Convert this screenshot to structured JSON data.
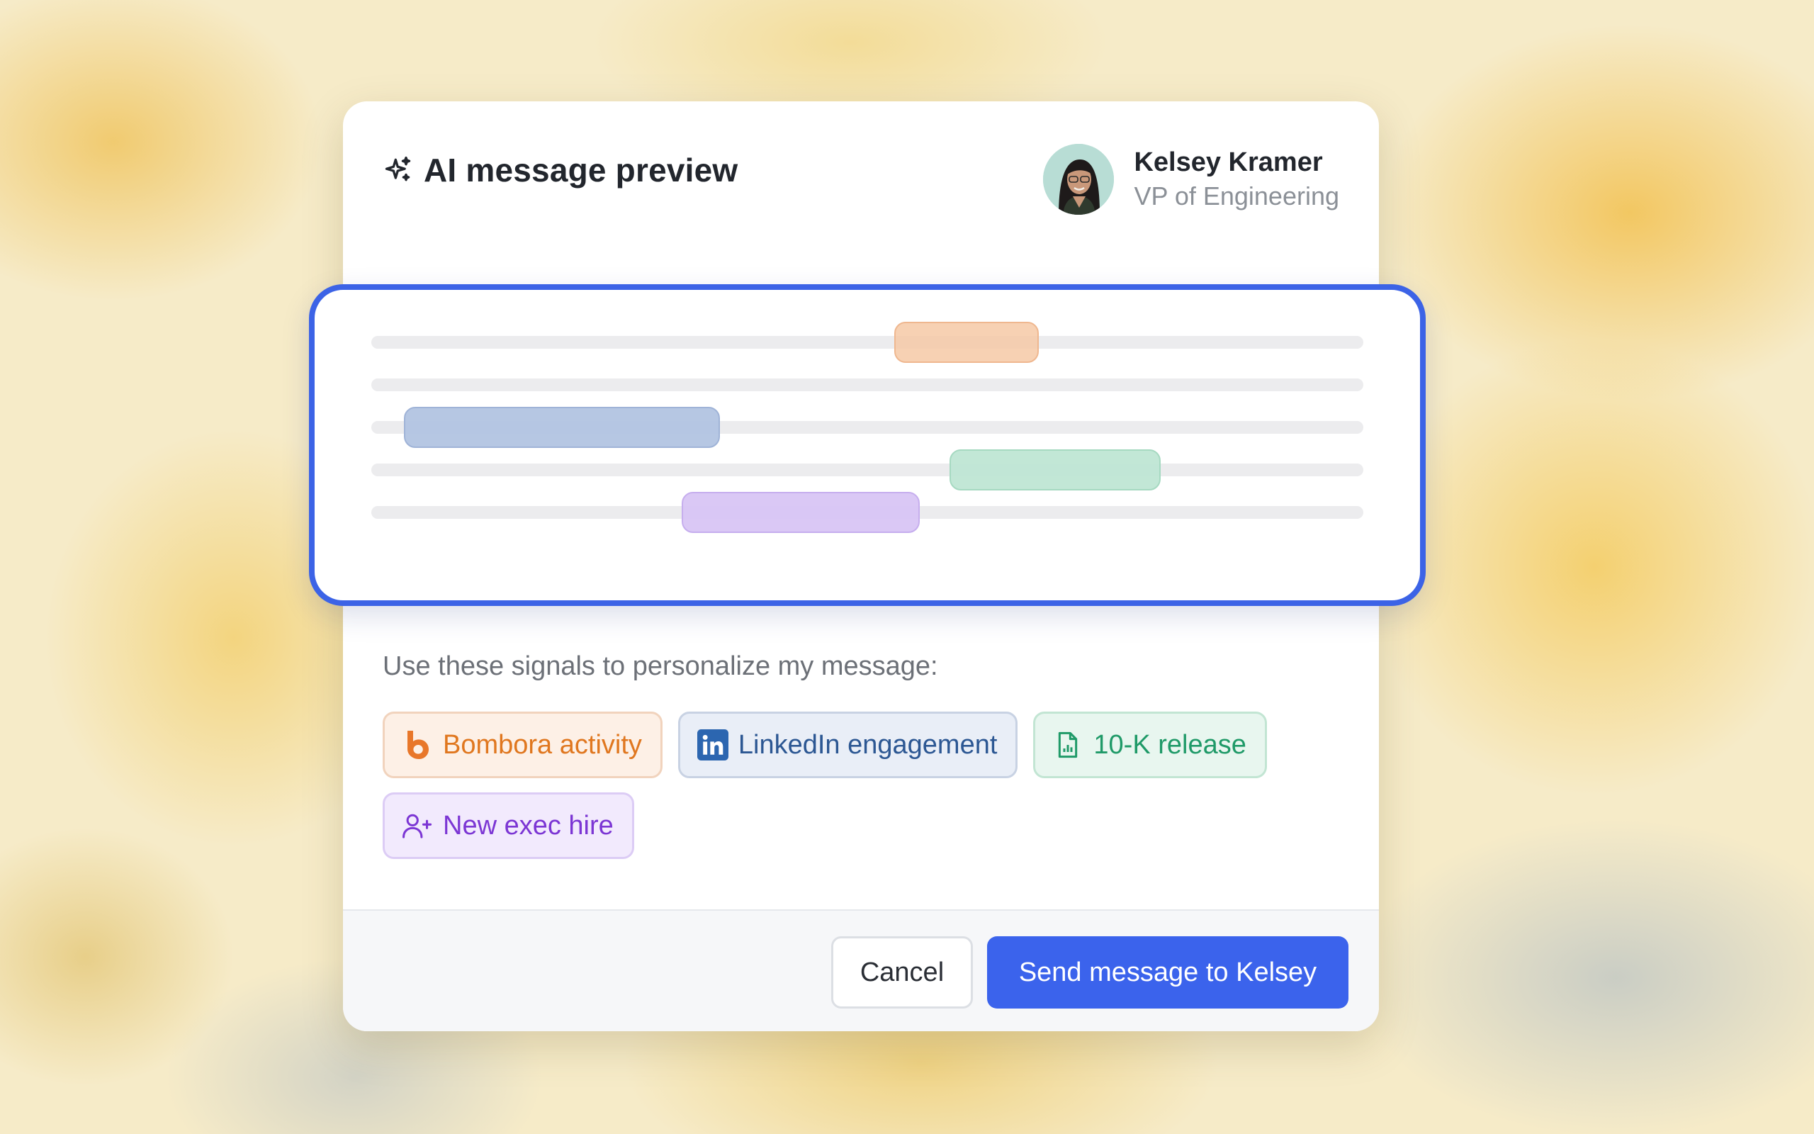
{
  "dialog": {
    "title": "AI message preview",
    "title_icon": "sparkle-icon"
  },
  "recipient": {
    "name": "Kelsey Kramer",
    "role": "VP of Engineering"
  },
  "signals": {
    "label": "Use these signals to personalize my message:",
    "chips": [
      {
        "label": "Bombora activity",
        "icon": "bombora-logo-icon",
        "color": "#e0771f"
      },
      {
        "label": "LinkedIn engagement",
        "icon": "linkedin-icon",
        "color": "#2c5793"
      },
      {
        "label": "10-K release",
        "icon": "document-chart-icon",
        "color": "#1f9a68"
      },
      {
        "label": "New exec hire",
        "icon": "user-plus-icon",
        "color": "#7c36d4"
      }
    ]
  },
  "actions": {
    "cancel_label": "Cancel",
    "send_label": "Send message to Kelsey"
  },
  "colors": {
    "accent": "#3b63ec",
    "highlight_orange": "#f6c9a6",
    "highlight_blue": "#b2c4e2",
    "highlight_green": "#bfe6d4",
    "highlight_purple": "#d8c5f4"
  }
}
